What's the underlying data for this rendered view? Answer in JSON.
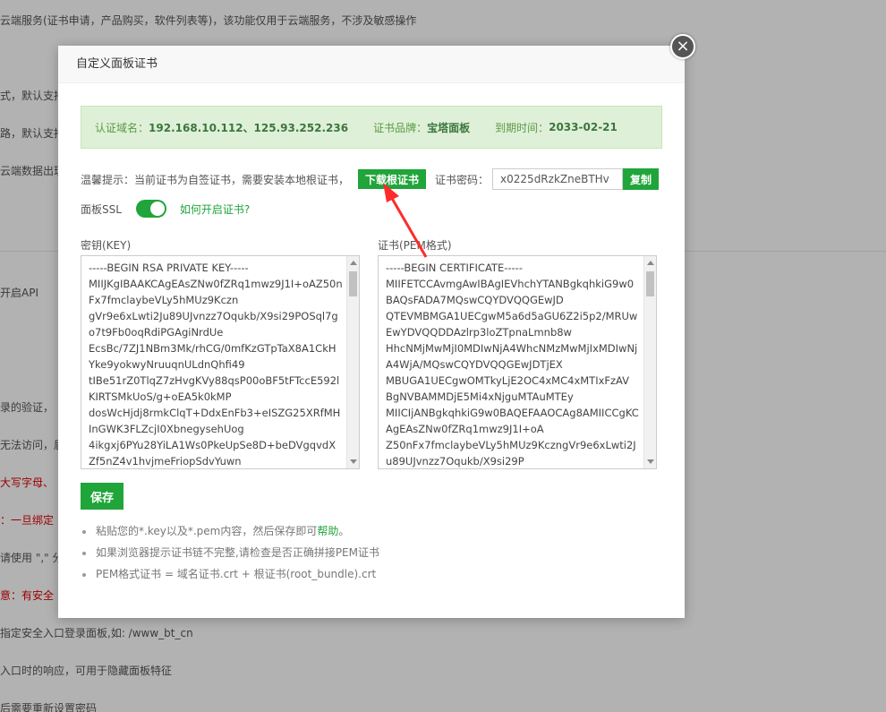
{
  "background": {
    "lines": [
      "云端服务(证书申请，产品购买，软件列表等)，该功能仅用于云端服务，不涉及敏感操作",
      "式，默认支持",
      "路，默认支持",
      "云端数据出现",
      "开启API",
      "录的验证，",
      "无法访问，届",
      "大写字母、",
      "：一旦绑定",
      "请使用 \",\" 分",
      "意：有安全",
      "指定安全入口登录面板,如: /www_bt_cn",
      "入口时的响应，可用于隐藏面板特征",
      "后需要重新设置密码"
    ]
  },
  "modal": {
    "title": "自定义面板证书",
    "close_symbol": "×"
  },
  "info": {
    "domain_label": "认证域名：",
    "domain_value": "192.168.10.112、125.93.252.236",
    "brand_label": "证书品牌：",
    "brand_value": "宝塔面板",
    "expire_label": "到期时间：",
    "expire_value": "2033-02-21"
  },
  "tip": {
    "text": "温馨提示：当前证书为自签证书，需要安装本地根证书，",
    "download_label": "下载根证书",
    "password_label": "证书密码：",
    "password_value": "x0225dRzkZneBTHv",
    "copy_label": "复制"
  },
  "ssl": {
    "label": "面板SSL",
    "enabled": true,
    "howto_label": "如何开启证书?"
  },
  "key": {
    "label": "密钥(KEY)",
    "content": "-----BEGIN RSA PRIVATE KEY-----\nMIIJKgIBAAKCAgEAsZNw0fZRq1mwz9J1I+oAZ50nFx7fmclaybeVLy5hMUz9Kczn\ngVr9e6xLwti2Ju89UJvnzz7Oqukb/X9si29POSql7go7t9Fb0oqRdiPGAgiNrdUe\nEcsBc/7ZJ1NBm3Mk/rhCG/0mfKzGTpTaX8A1CkH\nYke9yokwyNruuqnULdnQhfi49\ntIBe51rZ0TlqZ7zHvgKVy88qsP00oBF5tFTccE592l\nKIRTSMkUoS/g+oEA5k0kMP\ndosWcHjdj8rmkClqT+DdxEnFb3+eISZG25XRfMH\nInGWK3FLZcjI0XbnegysehUog\n4ikgxj6PYu28YiLA1Ws0PkeUpSe8D+beDVgqvdX\nZf5nZ4v1hvjmeFriopSdvYuwn"
  },
  "cert": {
    "label": "证书(PEM格式)",
    "content": "-----BEGIN CERTIFICATE-----\nMIIFETCCAvmgAwIBAgIEVhchYTANBgkqhkiG9w0BAQsFADA7MQswCQYDVQQGEwJD\nQTEVMBMGA1UECgwM5a6d5aGU6Z2i5p2/MRUwEwYDVQQDDAzlrp3loZTpnaLmnb8w\nHhcNMjMwMjI0MDIwNjA4WhcNMzMwMjIxMDIwNjA4WjA/MQswCQYDVQQGEwJDTjEX\nMBUGA1UECgwOMTkyLjE2OC4xMC4xMTIxFzAV\nBgNVBAMMDjE5Mi4xNjguMTAuMTEy\nMIICIjANBgkqhkiG9w0BAQEFAAOCAg8AMIICCgKCAgEAsZNw0fZRq1mwz9J1I+oA\nZ50nFx7fmclaybeVLy5hMUz9KczngVr9e6xLwti2Ju89UJvnzz7Oqukb/X9si29P"
  },
  "save_label": "保存",
  "notes": [
    {
      "text": "粘贴您的*.key以及*.pem内容，然后保存即可",
      "link": "帮助",
      "suffix": "。"
    },
    {
      "text": "如果浏览器提示证书链不完整,请检查是否正确拼接PEM证书",
      "link": "",
      "suffix": ""
    },
    {
      "text": "PEM格式证书 = 域名证书.crt + 根证书(root_bundle).crt",
      "link": "",
      "suffix": ""
    }
  ],
  "colors": {
    "accent": "#20a53a",
    "info_bg": "#dff0d8",
    "arrow": "#ff2a2a"
  }
}
